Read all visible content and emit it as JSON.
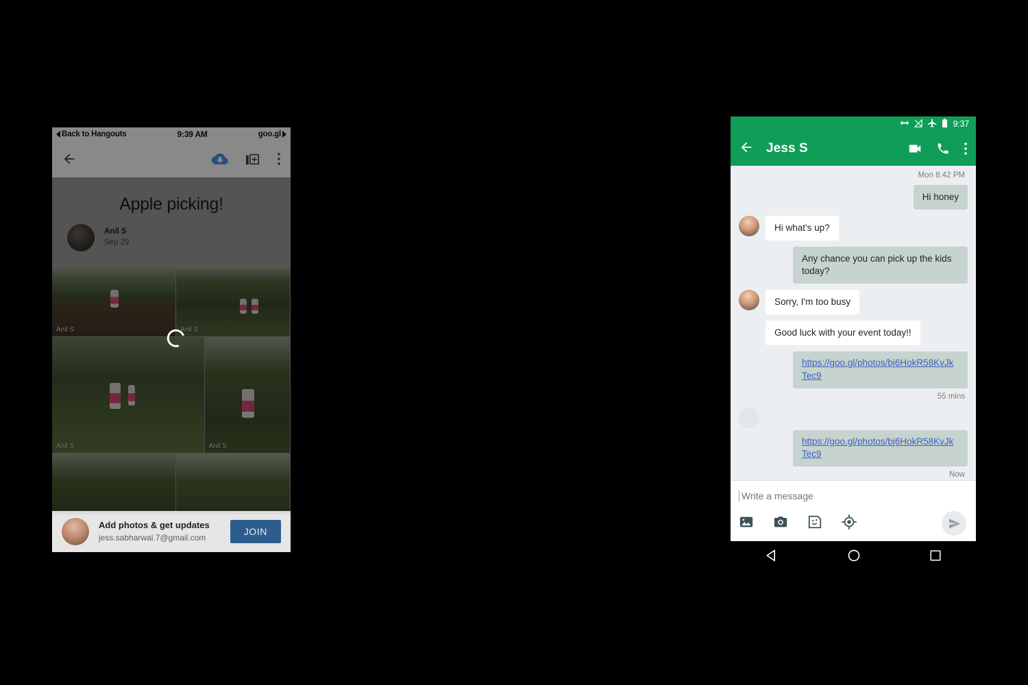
{
  "left_phone": {
    "status_bar": {
      "back_label": "Back to Hangouts",
      "time": "9:39 AM",
      "app_label": "goo.gl"
    },
    "toolbar": {
      "back_icon": "arrow-left-icon",
      "download_icon": "cloud-download-icon",
      "add_to_album_icon": "add-photos-icon",
      "overflow_icon": "more-vertical-icon"
    },
    "album": {
      "title": "Apple picking!",
      "owner_name": "Anil S",
      "date": "Sep 29",
      "photo_credit": "Anil S",
      "photo_count": 6,
      "loading": true
    },
    "join_bar": {
      "title": "Add photos & get updates",
      "email": "jess.sabharwal.7@gmail.com",
      "button_label": "JOIN"
    }
  },
  "right_phone": {
    "status_bar": {
      "time": "9:37",
      "icons": [
        "bidirectional-arrow-icon",
        "signal-off-icon",
        "airplane-mode-icon",
        "battery-icon"
      ]
    },
    "app_bar": {
      "back_icon": "arrow-left-icon",
      "contact_name": "Jess S",
      "video_call_icon": "video-call-icon",
      "phone_call_icon": "phone-call-icon",
      "overflow_icon": "more-vertical-icon"
    },
    "conversation": {
      "day_stamp": "Mon 8:42 PM",
      "messages": [
        {
          "text": "Hi honey",
          "direction": "out",
          "type": "text"
        },
        {
          "text": "Hi what's up?",
          "direction": "in",
          "type": "text",
          "avatar": true
        },
        {
          "text": "Any chance you can pick up the kids today?",
          "direction": "out",
          "type": "text"
        },
        {
          "text": "Sorry, I'm too busy",
          "direction": "in",
          "type": "text",
          "avatar": true
        },
        {
          "text": "Good luck with your event today!!",
          "direction": "in",
          "type": "text"
        },
        {
          "text": "https://goo.gl/photos/bj6HokR58KvJkTec9",
          "direction": "out",
          "type": "link",
          "timestamp": "55 mins"
        },
        {
          "text": "https://goo.gl/photos/bj6HokR58KvJkTec9",
          "direction": "out",
          "type": "link",
          "timestamp": "Now",
          "avatar_ghost": true
        }
      ],
      "timestamp_1": "55 mins",
      "timestamp_2": "Now"
    },
    "compose": {
      "placeholder": "Write a message",
      "value": "",
      "icons": [
        "photo-icon",
        "camera-icon",
        "sticker-icon",
        "location-icon"
      ],
      "send_icon": "send-icon"
    },
    "nav_bar": {
      "back_icon": "nav-back-triangle-icon",
      "home_icon": "nav-home-circle-icon",
      "recents_icon": "nav-recents-square-icon"
    }
  },
  "theme": {
    "android_green": "#0f9d58",
    "sent_bubble": "#c7d3cf",
    "received_bubble": "#ffffff",
    "link_color": "#3b5fc0",
    "join_button": "#2d5d8c",
    "chat_background": "#eceff1",
    "page_background": "#000000"
  }
}
